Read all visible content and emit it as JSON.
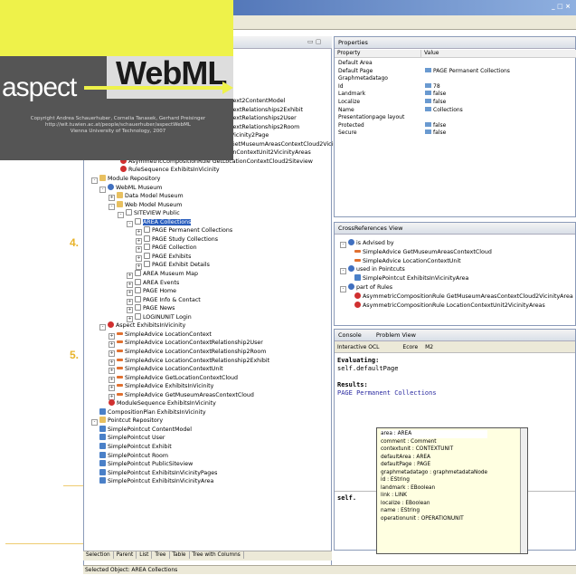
{
  "window": {
    "controls": "_ □ ×"
  },
  "logo": {
    "word1": "aspect",
    "word2": "WebML",
    "copyright_lines": [
      "Copyright Andrea Schauerhuber, Cornelia Tanasek, Gerhard Preisinger",
      "http://wit.tuwien.ac.at/people/schauerhuber/aspectWebML",
      "Vienna University of Technology, 2007"
    ]
  },
  "side_numbers": {
    "n4": "4.",
    "n5": "5."
  },
  "explorer": {
    "items": [
      {
        "indent": 158,
        "icon": "none",
        "text": "ntext2ContentModel"
      },
      {
        "indent": 158,
        "icon": "none",
        "text": "ntextRelationships2Exhibit"
      },
      {
        "indent": 158,
        "icon": "none",
        "text": "ntextRelationships2User"
      },
      {
        "indent": 158,
        "icon": "none",
        "text": "ntextRelationships2Room"
      },
      {
        "indent": 158,
        "icon": "none",
        "text": "nVicinity2Page"
      },
      {
        "indent": 158,
        "icon": "none",
        "text": "eGetMuseumAreasContextCloud2VicinityAreas"
      },
      {
        "indent": 40,
        "icon": "red",
        "text": "AsymmetricCompositionRule LocationContextUnit2VicinityAreas"
      },
      {
        "indent": 40,
        "icon": "red",
        "text": "AsymmetricCompositionRule GetLocationContextCloud2Siteview"
      },
      {
        "indent": 40,
        "icon": "red",
        "text": "RuleSequence ExhibitsInVicinity"
      },
      {
        "indent": 8,
        "icon": "fold",
        "text": "Module Repository",
        "exp": "-"
      },
      {
        "indent": 17,
        "icon": "blue",
        "text": "WebML Museum",
        "exp": "-"
      },
      {
        "indent": 27,
        "icon": "fold",
        "text": "Data Model Museum",
        "exp": "+"
      },
      {
        "indent": 27,
        "icon": "fold",
        "text": "Web Model Museum",
        "exp": "-"
      },
      {
        "indent": 37,
        "icon": "page",
        "text": "SITEVIEW Public",
        "exp": "-"
      },
      {
        "indent": 47,
        "icon": "page",
        "text": "AREA Collections",
        "exp": "-",
        "selected": true
      },
      {
        "indent": 57,
        "icon": "page",
        "text": "PAGE Permanent Collections",
        "exp": "+"
      },
      {
        "indent": 57,
        "icon": "page",
        "text": "PAGE Study Collections",
        "exp": "+"
      },
      {
        "indent": 57,
        "icon": "page",
        "text": "PAGE Collection",
        "exp": "+"
      },
      {
        "indent": 57,
        "icon": "page",
        "text": "PAGE Exhibits",
        "exp": "+"
      },
      {
        "indent": 57,
        "icon": "page",
        "text": "PAGE Exhibit Details",
        "exp": "+"
      },
      {
        "indent": 47,
        "icon": "page",
        "text": "AREA Museum Map",
        "exp": "+"
      },
      {
        "indent": 47,
        "icon": "page",
        "text": "AREA Events",
        "exp": "+"
      },
      {
        "indent": 47,
        "icon": "page",
        "text": "PAGE Home",
        "exp": "+"
      },
      {
        "indent": 47,
        "icon": "page",
        "text": "PAGE Info & Contact",
        "exp": "+"
      },
      {
        "indent": 47,
        "icon": "page",
        "text": "PAGE News",
        "exp": "+"
      },
      {
        "indent": 47,
        "icon": "page",
        "text": "LOGINUNIT Login",
        "exp": "+"
      },
      {
        "indent": 17,
        "icon": "red",
        "text": "Aspect ExhibitsInVicinity",
        "exp": "-"
      },
      {
        "indent": 27,
        "icon": "arrow",
        "text": "SimpleAdvice LocationContext",
        "exp": "+"
      },
      {
        "indent": 27,
        "icon": "arrow",
        "text": "SimpleAdvice LocationContextRelationship2User",
        "exp": "+"
      },
      {
        "indent": 27,
        "icon": "arrow",
        "text": "SimpleAdvice LocationContextRelationship2Room",
        "exp": "+"
      },
      {
        "indent": 27,
        "icon": "arrow",
        "text": "SimpleAdvice LocationContextRelationship2Exhibit",
        "exp": "+"
      },
      {
        "indent": 27,
        "icon": "arrow",
        "text": "SimpleAdvice LocationContextUnit",
        "exp": "+"
      },
      {
        "indent": 27,
        "icon": "arrow",
        "text": "SimpleAdvice GetLocationContextCloud",
        "exp": "+"
      },
      {
        "indent": 27,
        "icon": "arrow",
        "text": "SimpleAdvice ExhibitsInVicinity",
        "exp": "+"
      },
      {
        "indent": 27,
        "icon": "arrow",
        "text": "SimpleAdvice GetMuseumAreasContextCloud",
        "exp": "+"
      },
      {
        "indent": 27,
        "icon": "red",
        "text": "ModuleSequence ExhibitsInVicinity"
      },
      {
        "indent": 17,
        "icon": "pc",
        "text": "CompositionPlan ExhibitsInVicinity"
      },
      {
        "indent": 8,
        "icon": "fold",
        "text": "Pointcut Repository",
        "exp": "-"
      },
      {
        "indent": 17,
        "icon": "pc",
        "text": "SimplePointcut ContentModel"
      },
      {
        "indent": 17,
        "icon": "pc",
        "text": "SimplePointcut User"
      },
      {
        "indent": 17,
        "icon": "pc",
        "text": "SimplePointcut Exhibit"
      },
      {
        "indent": 17,
        "icon": "pc",
        "text": "SimplePointcut Room"
      },
      {
        "indent": 17,
        "icon": "pc",
        "text": "SimplePointcut PublicSiteview"
      },
      {
        "indent": 17,
        "icon": "pc",
        "text": "SimplePointcut ExhibitsInVicinityPages"
      },
      {
        "indent": 17,
        "icon": "pc",
        "text": "SimplePointcut ExhibitsInVicinityArea"
      }
    ],
    "bottom_tabs": [
      "Selection",
      "Parent",
      "List",
      "Tree",
      "Table",
      "Tree with Columns"
    ]
  },
  "status": "Selected Object: AREA Collections",
  "properties": {
    "title": "Properties",
    "col_property": "Property",
    "col_value": "Value",
    "rows": [
      {
        "k": "Default Area",
        "v": "",
        "ico": false
      },
      {
        "k": "Default Page",
        "v": "PAGE Permanent Collections",
        "ico": true
      },
      {
        "k": "Graphmetadatago",
        "v": "",
        "ico": false
      },
      {
        "k": "Id",
        "v": "78",
        "ico": true
      },
      {
        "k": "Landmark",
        "v": "false",
        "ico": true
      },
      {
        "k": "Localize",
        "v": "false",
        "ico": true
      },
      {
        "k": "Name",
        "v": "Collections",
        "ico": true
      },
      {
        "k": "Presentationpage layout",
        "v": "",
        "ico": false
      },
      {
        "k": "Protected",
        "v": "false",
        "ico": true
      },
      {
        "k": "Secure",
        "v": "false",
        "ico": true
      }
    ]
  },
  "crossref": {
    "title": "CrossReferences View",
    "items": [
      {
        "indent": 6,
        "icon": "blue",
        "text": "is Advised by",
        "exp": "-"
      },
      {
        "indent": 22,
        "icon": "arrow",
        "text": "SimpleAdvice GetMuseumAreasContextCloud"
      },
      {
        "indent": 22,
        "icon": "arrow",
        "text": "SimpleAdvice LocationContextUnit"
      },
      {
        "indent": 6,
        "icon": "blue",
        "text": "used in Pointcuts",
        "exp": "-"
      },
      {
        "indent": 22,
        "icon": "pc",
        "text": "SimplePointcut ExhibitsInVicinityArea"
      },
      {
        "indent": 6,
        "icon": "blue",
        "text": "part of Rules",
        "exp": "-"
      },
      {
        "indent": 22,
        "icon": "red",
        "text": "AsymmetricCompositionRule GetMuseumAreasContextCloud2VicinityArea"
      },
      {
        "indent": 22,
        "icon": "red",
        "text": "AsymmetricCompositionRule LocationContextUnit2VicinityAreas"
      }
    ]
  },
  "console": {
    "tab1": "Console",
    "tab2": "Problem View",
    "toolbar_label": "Interactive OCL",
    "mode": "Ecore",
    "level": "M2",
    "evaluating_label": "Evaluating:",
    "expr": "self.defaultPage",
    "results_label": "Results:",
    "result": "PAGE Permanent Collections",
    "input": "self."
  },
  "popup": {
    "items": [
      "area : AREA",
      "comment : Comment",
      "contextunit : CONTEXTUNIT",
      "defaultArea : AREA",
      "defaultPage : PAGE",
      "graphmetadatago : graphmetadataNode",
      "id : EString",
      "landmark : EBoolean",
      "link : LINK",
      "localize : EBoolean",
      "name : EString",
      "operationunit : OPERATIONUNIT"
    ]
  }
}
